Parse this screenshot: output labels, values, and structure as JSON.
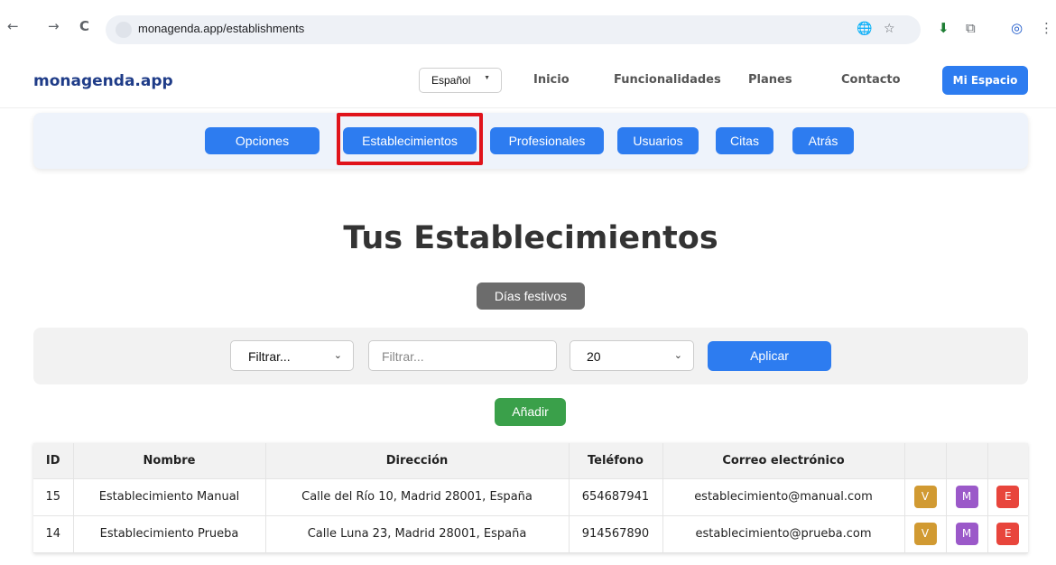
{
  "browser": {
    "url": "monagenda.app/establishments",
    "back_icon": "←",
    "forward_icon": "→",
    "reload_icon": "C",
    "translate_icon": "🌐",
    "star_icon": "☆",
    "download_icon": "⬇",
    "extensions_icon": "⧉",
    "profile_icon": "◎",
    "menu_icon": "⋮"
  },
  "header": {
    "logo": "monagenda.app",
    "language": "Español",
    "nav": [
      "Inicio",
      "Funcionalidades",
      "Planes",
      "Contacto"
    ],
    "cta": "Mi Espacio"
  },
  "subnav": [
    "Opciones",
    "Establecimientos",
    "Profesionales",
    "Usuarios",
    "Citas",
    "Atrás"
  ],
  "main": {
    "title": "Tus Establecimientos",
    "holidays_button": "Días festivos",
    "filter": {
      "field_select": "Filtrar...",
      "input_placeholder": "Filtrar...",
      "page_size": "20",
      "apply_button": "Aplicar"
    },
    "add_button": "Añadir"
  },
  "table": {
    "headers": [
      "ID",
      "Nombre",
      "Dirección",
      "Teléfono",
      "Correo electrónico",
      "",
      "",
      ""
    ],
    "action_labels": [
      "V",
      "M",
      "E"
    ],
    "rows": [
      {
        "id": "15",
        "name": "Establecimiento Manual",
        "address": "Calle del Río 10, Madrid 28001, España",
        "phone": "654687941",
        "email": "establecimiento@manual.com"
      },
      {
        "id": "14",
        "name": "Establecimiento Prueba",
        "address": "Calle Luna 23, Madrid 28001, España",
        "phone": "914567890",
        "email": "establecimiento@prueba.com"
      }
    ]
  },
  "colors": {
    "primary": "#2d7cf0",
    "highlight": "#e0131b",
    "success": "#3aa04a",
    "secondary": "#6c6c6c",
    "view": "#d19a32",
    "modify": "#9b59c9",
    "delete": "#e8453c"
  }
}
